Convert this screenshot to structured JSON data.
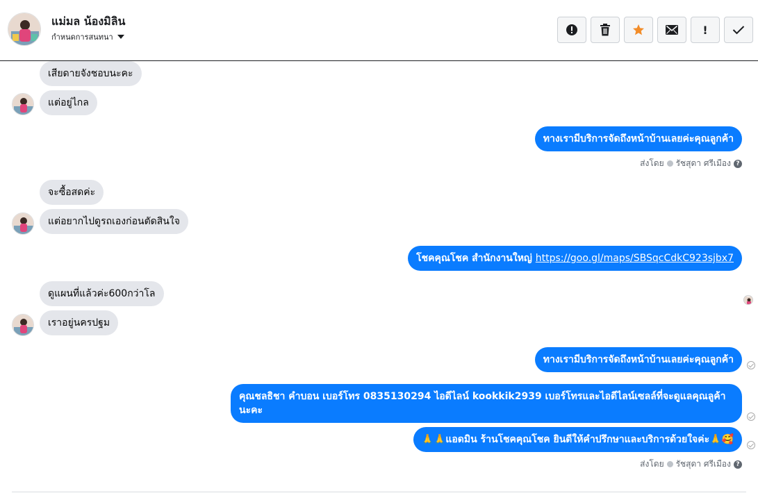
{
  "header": {
    "contact_name": "แม่มล น้องมิลิน",
    "settings_label": "กำหนดการสนทนา"
  },
  "toolbar": {
    "buttons": [
      {
        "name": "alert-circle-icon",
        "label": "!"
      },
      {
        "name": "trash-icon",
        "label": ""
      },
      {
        "name": "star-icon",
        "label": ""
      },
      {
        "name": "envelope-icon",
        "label": ""
      },
      {
        "name": "exclamation-icon",
        "label": "!"
      },
      {
        "name": "checkmark-icon",
        "label": ""
      }
    ]
  },
  "colors": {
    "outgoing_bubble": "#0a7cff",
    "incoming_bubble": "#e4e6eb",
    "star": "#f28c28"
  },
  "messages": [
    {
      "dir": "in",
      "text": "เสียดายจังชอบนะคะ"
    },
    {
      "dir": "in",
      "text": "แต่อยู่ไกล"
    },
    {
      "dir": "out",
      "text": "ทางเรามีบริการจัดถึงหน้าบ้านเลยค่ะคุณลูกค้า"
    },
    {
      "dir": "in",
      "text": "จะซื้อสดค่ะ"
    },
    {
      "dir": "in",
      "text": "แต่อยากไปดูรถเองก่อนตัดสินใจ"
    },
    {
      "dir": "out",
      "text": "โชคคุณโชค สำนักงานใหญ่",
      "link": "https://goo.gl/maps/SBSqcCdkC923sjbx7"
    },
    {
      "dir": "in",
      "text": "ดูแผนที่แล้วค่ะ600กว่าโล"
    },
    {
      "dir": "in",
      "text": "เราอยู่นครปฐม"
    },
    {
      "dir": "out",
      "text": "ทางเรามีบริการจัดถึงหน้าบ้านเลยค่ะคุณลูกค้า"
    },
    {
      "dir": "out",
      "text": "คุณชลธิชา คำบอน เบอร์โทร 0835130294  ไอดีไลน์ kookkik2939   เบอร์โทรและไอดีไลน์เซลล์ที่จะดูแลคุณลูค้านะคะ"
    },
    {
      "dir": "out",
      "text": "🙏🙏แอดมิน ร้านโชคคุณโชค ยินดีให้คำปรึกษาและบริการด้วยใจค่ะ🙏🥰"
    }
  ],
  "sent_by": {
    "label": "ส่งโดย",
    "agent": "รัชสุดา ศรีเมือง",
    "help": "?"
  }
}
